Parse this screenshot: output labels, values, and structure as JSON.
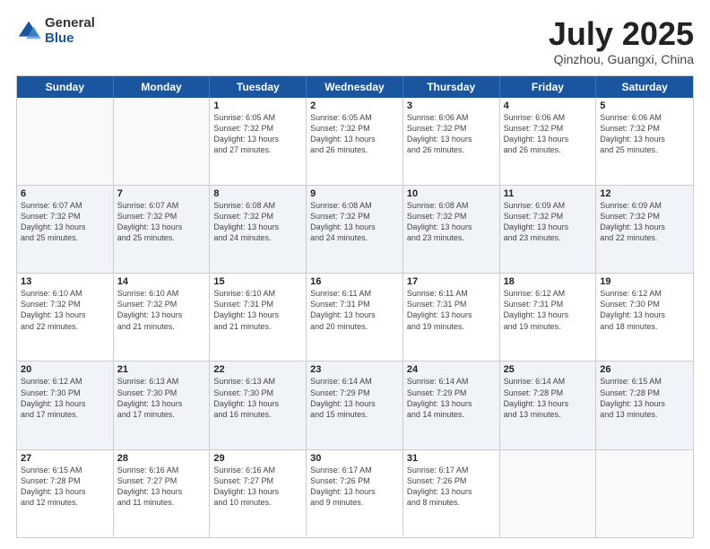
{
  "header": {
    "logo_general": "General",
    "logo_blue": "Blue",
    "title": "July 2025",
    "location": "Qinzhou, Guangxi, China"
  },
  "day_headers": [
    "Sunday",
    "Monday",
    "Tuesday",
    "Wednesday",
    "Thursday",
    "Friday",
    "Saturday"
  ],
  "weeks": [
    [
      {
        "num": "",
        "info": ""
      },
      {
        "num": "",
        "info": ""
      },
      {
        "num": "1",
        "info": "Sunrise: 6:05 AM\nSunset: 7:32 PM\nDaylight: 13 hours\nand 27 minutes."
      },
      {
        "num": "2",
        "info": "Sunrise: 6:05 AM\nSunset: 7:32 PM\nDaylight: 13 hours\nand 26 minutes."
      },
      {
        "num": "3",
        "info": "Sunrise: 6:06 AM\nSunset: 7:32 PM\nDaylight: 13 hours\nand 26 minutes."
      },
      {
        "num": "4",
        "info": "Sunrise: 6:06 AM\nSunset: 7:32 PM\nDaylight: 13 hours\nand 26 minutes."
      },
      {
        "num": "5",
        "info": "Sunrise: 6:06 AM\nSunset: 7:32 PM\nDaylight: 13 hours\nand 25 minutes."
      }
    ],
    [
      {
        "num": "6",
        "info": "Sunrise: 6:07 AM\nSunset: 7:32 PM\nDaylight: 13 hours\nand 25 minutes."
      },
      {
        "num": "7",
        "info": "Sunrise: 6:07 AM\nSunset: 7:32 PM\nDaylight: 13 hours\nand 25 minutes."
      },
      {
        "num": "8",
        "info": "Sunrise: 6:08 AM\nSunset: 7:32 PM\nDaylight: 13 hours\nand 24 minutes."
      },
      {
        "num": "9",
        "info": "Sunrise: 6:08 AM\nSunset: 7:32 PM\nDaylight: 13 hours\nand 24 minutes."
      },
      {
        "num": "10",
        "info": "Sunrise: 6:08 AM\nSunset: 7:32 PM\nDaylight: 13 hours\nand 23 minutes."
      },
      {
        "num": "11",
        "info": "Sunrise: 6:09 AM\nSunset: 7:32 PM\nDaylight: 13 hours\nand 23 minutes."
      },
      {
        "num": "12",
        "info": "Sunrise: 6:09 AM\nSunset: 7:32 PM\nDaylight: 13 hours\nand 22 minutes."
      }
    ],
    [
      {
        "num": "13",
        "info": "Sunrise: 6:10 AM\nSunset: 7:32 PM\nDaylight: 13 hours\nand 22 minutes."
      },
      {
        "num": "14",
        "info": "Sunrise: 6:10 AM\nSunset: 7:32 PM\nDaylight: 13 hours\nand 21 minutes."
      },
      {
        "num": "15",
        "info": "Sunrise: 6:10 AM\nSunset: 7:31 PM\nDaylight: 13 hours\nand 21 minutes."
      },
      {
        "num": "16",
        "info": "Sunrise: 6:11 AM\nSunset: 7:31 PM\nDaylight: 13 hours\nand 20 minutes."
      },
      {
        "num": "17",
        "info": "Sunrise: 6:11 AM\nSunset: 7:31 PM\nDaylight: 13 hours\nand 19 minutes."
      },
      {
        "num": "18",
        "info": "Sunrise: 6:12 AM\nSunset: 7:31 PM\nDaylight: 13 hours\nand 19 minutes."
      },
      {
        "num": "19",
        "info": "Sunrise: 6:12 AM\nSunset: 7:30 PM\nDaylight: 13 hours\nand 18 minutes."
      }
    ],
    [
      {
        "num": "20",
        "info": "Sunrise: 6:12 AM\nSunset: 7:30 PM\nDaylight: 13 hours\nand 17 minutes."
      },
      {
        "num": "21",
        "info": "Sunrise: 6:13 AM\nSunset: 7:30 PM\nDaylight: 13 hours\nand 17 minutes."
      },
      {
        "num": "22",
        "info": "Sunrise: 6:13 AM\nSunset: 7:30 PM\nDaylight: 13 hours\nand 16 minutes."
      },
      {
        "num": "23",
        "info": "Sunrise: 6:14 AM\nSunset: 7:29 PM\nDaylight: 13 hours\nand 15 minutes."
      },
      {
        "num": "24",
        "info": "Sunrise: 6:14 AM\nSunset: 7:29 PM\nDaylight: 13 hours\nand 14 minutes."
      },
      {
        "num": "25",
        "info": "Sunrise: 6:14 AM\nSunset: 7:28 PM\nDaylight: 13 hours\nand 13 minutes."
      },
      {
        "num": "26",
        "info": "Sunrise: 6:15 AM\nSunset: 7:28 PM\nDaylight: 13 hours\nand 13 minutes."
      }
    ],
    [
      {
        "num": "27",
        "info": "Sunrise: 6:15 AM\nSunset: 7:28 PM\nDaylight: 13 hours\nand 12 minutes."
      },
      {
        "num": "28",
        "info": "Sunrise: 6:16 AM\nSunset: 7:27 PM\nDaylight: 13 hours\nand 11 minutes."
      },
      {
        "num": "29",
        "info": "Sunrise: 6:16 AM\nSunset: 7:27 PM\nDaylight: 13 hours\nand 10 minutes."
      },
      {
        "num": "30",
        "info": "Sunrise: 6:17 AM\nSunset: 7:26 PM\nDaylight: 13 hours\nand 9 minutes."
      },
      {
        "num": "31",
        "info": "Sunrise: 6:17 AM\nSunset: 7:26 PM\nDaylight: 13 hours\nand 8 minutes."
      },
      {
        "num": "",
        "info": ""
      },
      {
        "num": "",
        "info": ""
      }
    ]
  ]
}
